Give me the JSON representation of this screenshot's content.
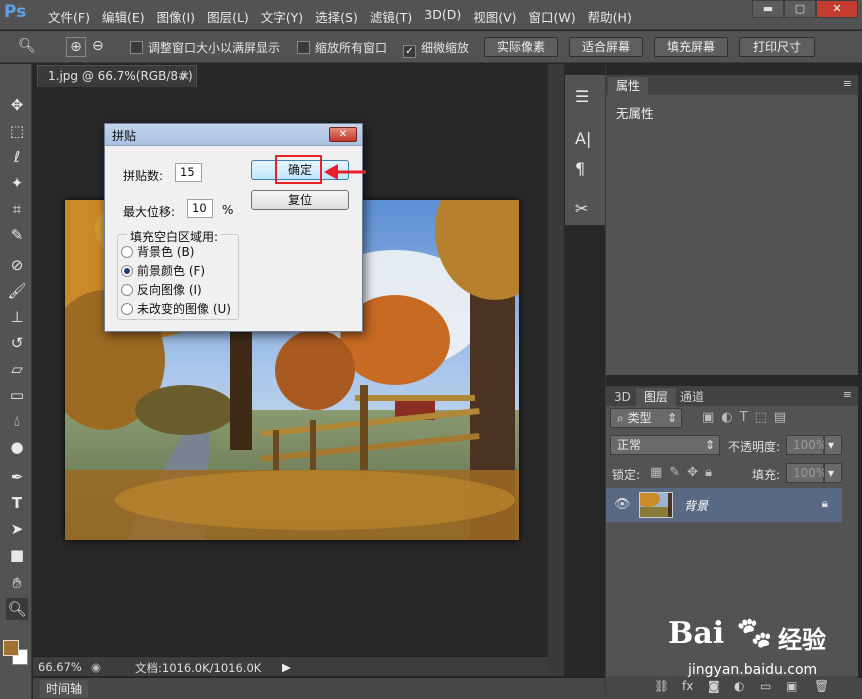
{
  "app": {
    "logo": "Ps"
  },
  "menu": [
    "文件(F)",
    "编辑(E)",
    "图像(I)",
    "图层(L)",
    "文字(Y)",
    "选择(S)",
    "滤镜(T)",
    "3D(D)",
    "视图(V)",
    "窗口(W)",
    "帮助(H)"
  ],
  "window_controls": {
    "minimize": "▬",
    "maximize": "▢",
    "close": "✕"
  },
  "options": {
    "resize_windows": "调整窗口大小以满屏显示",
    "zoom_all": "缩放所有窗口",
    "scrubby_zoom": "细微缩放",
    "scrubby_checked": true,
    "btn_actual": "实际像素",
    "btn_fit": "适合屏幕",
    "btn_fill": "填充屏幕",
    "btn_print": "打印尺寸"
  },
  "document": {
    "tab_title": "1.jpg @ 66.7%(RGB/8#)",
    "tab_close": "×"
  },
  "status": {
    "zoom": "66.67%",
    "doc_info": "文档:1016.0K/1016.0K"
  },
  "timeline": {
    "label": "时间轴"
  },
  "properties": {
    "tab": "属性",
    "empty": "无属性"
  },
  "layers": {
    "tabs": [
      "3D",
      "图层",
      "通道"
    ],
    "filter_kind": "类型",
    "blend_mode": "正常",
    "opacity_label": "不透明度:",
    "opacity_value": "100%",
    "lock_label": "锁定:",
    "fill_label": "填充:",
    "fill_value": "100%",
    "layer_name": "背景"
  },
  "dialog": {
    "title": "拼贴",
    "tiles_label": "拼贴数:",
    "tiles_value": "15",
    "offset_label": "最大位移:",
    "offset_value": "10",
    "offset_unit": "%",
    "ok": "确定",
    "reset": "复位",
    "fill_group": "填充空白区域用:",
    "options": [
      {
        "label": "背景色 (B)",
        "selected": false
      },
      {
        "label": "前景颜色 (F)",
        "selected": true
      },
      {
        "label": "反向图像 (I)",
        "selected": false
      },
      {
        "label": "未改变的图像 (U)",
        "selected": false
      }
    ]
  },
  "watermark": {
    "brand": "Bai",
    "brand2": "经验",
    "url": "jingyan.baidu.com"
  },
  "colors": {
    "foreground": "#a07030",
    "background": "#ffffff",
    "highlight": "#e8202a",
    "selected_layer": "#596883"
  }
}
